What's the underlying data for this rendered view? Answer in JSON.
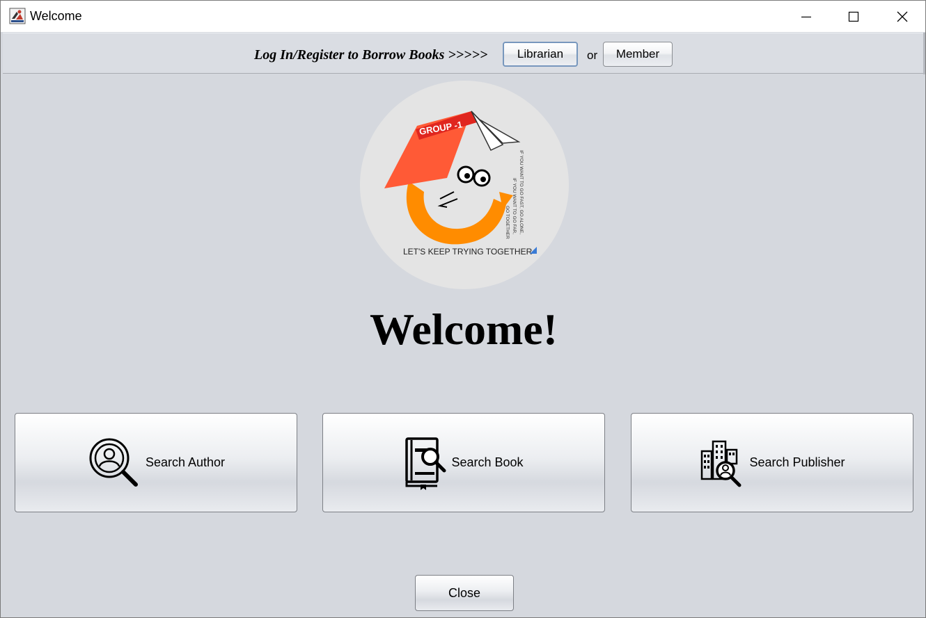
{
  "window": {
    "title": "Welcome",
    "icon": "java-cup-icon"
  },
  "topbar": {
    "prompt": "Log In/Register to Borrow Books >>>>>",
    "librarian_label": "Librarian",
    "or_text": "or",
    "member_label": "Member"
  },
  "logo": {
    "banner_text": "GROUP -1",
    "tagline": "LET'S KEEP TRYING TOGETHER",
    "side_text_1": "IF YOU WANT TO GO FAST, GO ALONE,",
    "side_text_2": "IF YOU WANT TO GO FAR,",
    "side_text_3": "GO TOGETHER"
  },
  "main": {
    "heading": "Welcome!"
  },
  "actions": {
    "search_author": "Search Author",
    "search_book": "Search Book",
    "search_publisher": "Search Publisher",
    "close": "Close"
  },
  "colors": {
    "window_bg": "#d5d8de",
    "logo_bg": "#e4e4e4",
    "logo_red": "#ff5a36",
    "logo_dark_red": "#e0261f",
    "logo_orange": "#ff8c00",
    "librarian_focus_border": "#7797bd"
  }
}
